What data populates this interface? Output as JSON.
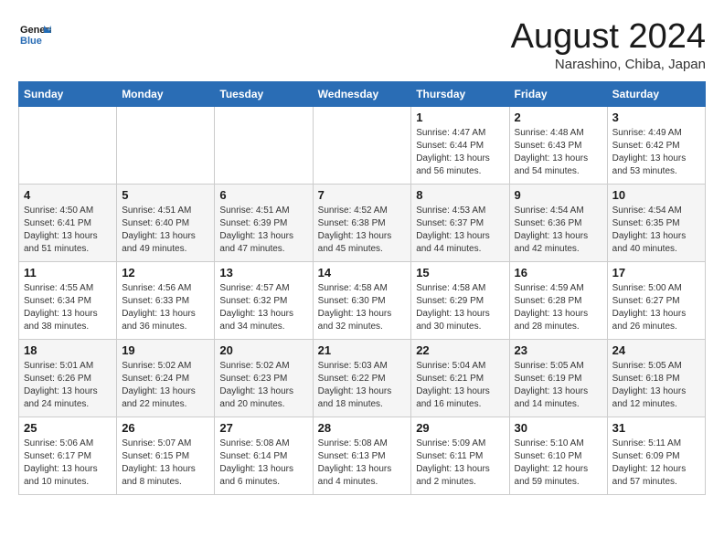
{
  "header": {
    "logo_line1": "General",
    "logo_line2": "Blue",
    "month_title": "August 2024",
    "location": "Narashino, Chiba, Japan"
  },
  "weekdays": [
    "Sunday",
    "Monday",
    "Tuesday",
    "Wednesday",
    "Thursday",
    "Friday",
    "Saturday"
  ],
  "weeks": [
    [
      {
        "day": "",
        "info": ""
      },
      {
        "day": "",
        "info": ""
      },
      {
        "day": "",
        "info": ""
      },
      {
        "day": "",
        "info": ""
      },
      {
        "day": "1",
        "info": "Sunrise: 4:47 AM\nSunset: 6:44 PM\nDaylight: 13 hours\nand 56 minutes."
      },
      {
        "day": "2",
        "info": "Sunrise: 4:48 AM\nSunset: 6:43 PM\nDaylight: 13 hours\nand 54 minutes."
      },
      {
        "day": "3",
        "info": "Sunrise: 4:49 AM\nSunset: 6:42 PM\nDaylight: 13 hours\nand 53 minutes."
      }
    ],
    [
      {
        "day": "4",
        "info": "Sunrise: 4:50 AM\nSunset: 6:41 PM\nDaylight: 13 hours\nand 51 minutes."
      },
      {
        "day": "5",
        "info": "Sunrise: 4:51 AM\nSunset: 6:40 PM\nDaylight: 13 hours\nand 49 minutes."
      },
      {
        "day": "6",
        "info": "Sunrise: 4:51 AM\nSunset: 6:39 PM\nDaylight: 13 hours\nand 47 minutes."
      },
      {
        "day": "7",
        "info": "Sunrise: 4:52 AM\nSunset: 6:38 PM\nDaylight: 13 hours\nand 45 minutes."
      },
      {
        "day": "8",
        "info": "Sunrise: 4:53 AM\nSunset: 6:37 PM\nDaylight: 13 hours\nand 44 minutes."
      },
      {
        "day": "9",
        "info": "Sunrise: 4:54 AM\nSunset: 6:36 PM\nDaylight: 13 hours\nand 42 minutes."
      },
      {
        "day": "10",
        "info": "Sunrise: 4:54 AM\nSunset: 6:35 PM\nDaylight: 13 hours\nand 40 minutes."
      }
    ],
    [
      {
        "day": "11",
        "info": "Sunrise: 4:55 AM\nSunset: 6:34 PM\nDaylight: 13 hours\nand 38 minutes."
      },
      {
        "day": "12",
        "info": "Sunrise: 4:56 AM\nSunset: 6:33 PM\nDaylight: 13 hours\nand 36 minutes."
      },
      {
        "day": "13",
        "info": "Sunrise: 4:57 AM\nSunset: 6:32 PM\nDaylight: 13 hours\nand 34 minutes."
      },
      {
        "day": "14",
        "info": "Sunrise: 4:58 AM\nSunset: 6:30 PM\nDaylight: 13 hours\nand 32 minutes."
      },
      {
        "day": "15",
        "info": "Sunrise: 4:58 AM\nSunset: 6:29 PM\nDaylight: 13 hours\nand 30 minutes."
      },
      {
        "day": "16",
        "info": "Sunrise: 4:59 AM\nSunset: 6:28 PM\nDaylight: 13 hours\nand 28 minutes."
      },
      {
        "day": "17",
        "info": "Sunrise: 5:00 AM\nSunset: 6:27 PM\nDaylight: 13 hours\nand 26 minutes."
      }
    ],
    [
      {
        "day": "18",
        "info": "Sunrise: 5:01 AM\nSunset: 6:26 PM\nDaylight: 13 hours\nand 24 minutes."
      },
      {
        "day": "19",
        "info": "Sunrise: 5:02 AM\nSunset: 6:24 PM\nDaylight: 13 hours\nand 22 minutes."
      },
      {
        "day": "20",
        "info": "Sunrise: 5:02 AM\nSunset: 6:23 PM\nDaylight: 13 hours\nand 20 minutes."
      },
      {
        "day": "21",
        "info": "Sunrise: 5:03 AM\nSunset: 6:22 PM\nDaylight: 13 hours\nand 18 minutes."
      },
      {
        "day": "22",
        "info": "Sunrise: 5:04 AM\nSunset: 6:21 PM\nDaylight: 13 hours\nand 16 minutes."
      },
      {
        "day": "23",
        "info": "Sunrise: 5:05 AM\nSunset: 6:19 PM\nDaylight: 13 hours\nand 14 minutes."
      },
      {
        "day": "24",
        "info": "Sunrise: 5:05 AM\nSunset: 6:18 PM\nDaylight: 13 hours\nand 12 minutes."
      }
    ],
    [
      {
        "day": "25",
        "info": "Sunrise: 5:06 AM\nSunset: 6:17 PM\nDaylight: 13 hours\nand 10 minutes."
      },
      {
        "day": "26",
        "info": "Sunrise: 5:07 AM\nSunset: 6:15 PM\nDaylight: 13 hours\nand 8 minutes."
      },
      {
        "day": "27",
        "info": "Sunrise: 5:08 AM\nSunset: 6:14 PM\nDaylight: 13 hours\nand 6 minutes."
      },
      {
        "day": "28",
        "info": "Sunrise: 5:08 AM\nSunset: 6:13 PM\nDaylight: 13 hours\nand 4 minutes."
      },
      {
        "day": "29",
        "info": "Sunrise: 5:09 AM\nSunset: 6:11 PM\nDaylight: 13 hours\nand 2 minutes."
      },
      {
        "day": "30",
        "info": "Sunrise: 5:10 AM\nSunset: 6:10 PM\nDaylight: 12 hours\nand 59 minutes."
      },
      {
        "day": "31",
        "info": "Sunrise: 5:11 AM\nSunset: 6:09 PM\nDaylight: 12 hours\nand 57 minutes."
      }
    ]
  ]
}
